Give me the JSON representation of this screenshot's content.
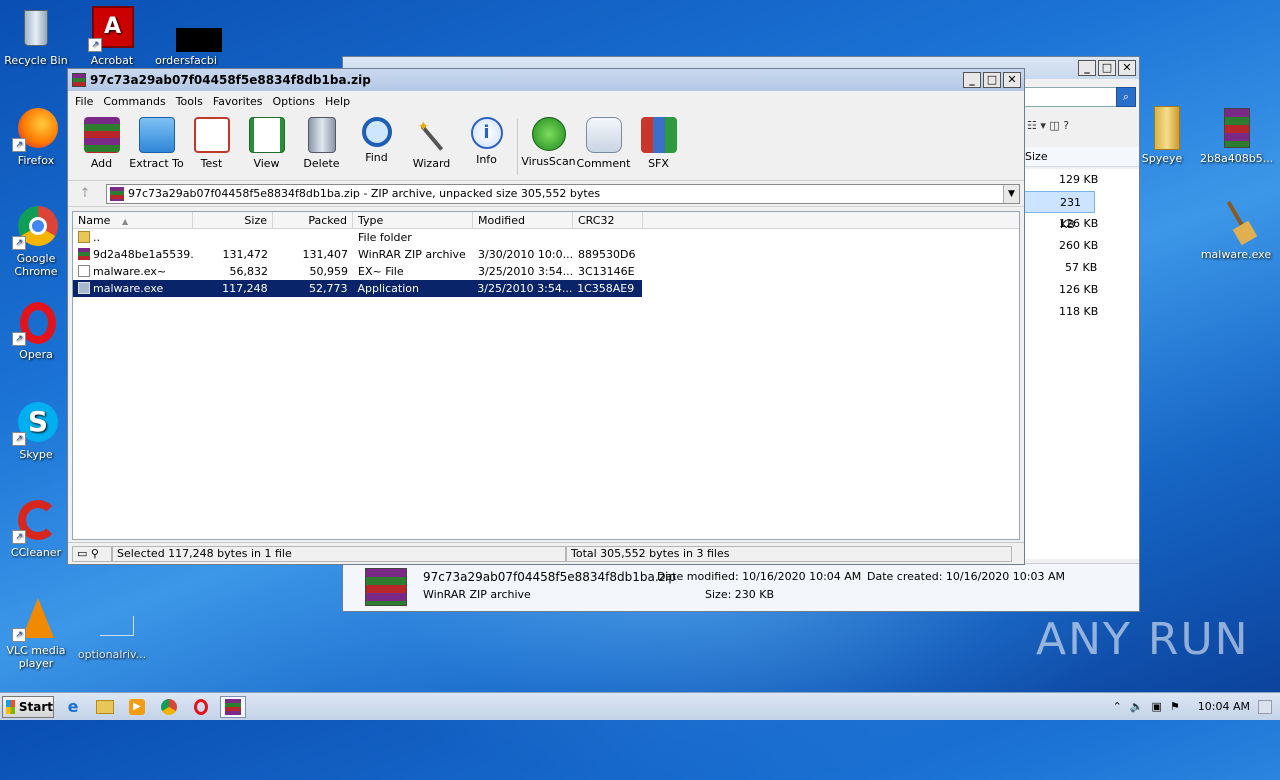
{
  "desktop": {
    "icons_left": [
      {
        "label": "Recycle Bin",
        "icon": "recycle-bin-icon"
      },
      {
        "label": "Acrobat",
        "icon": "acrobat-icon"
      },
      {
        "label": "ordersfacbi",
        "icon": "file-icon"
      },
      {
        "label": "Firefox",
        "icon": "firefox-icon"
      },
      {
        "label": "Google Chrome",
        "icon": "chrome-icon"
      },
      {
        "label": "Opera",
        "icon": "opera-icon"
      },
      {
        "label": "Skype",
        "icon": "skype-icon"
      },
      {
        "label": "CCleaner",
        "icon": "ccleaner-icon"
      },
      {
        "label": "VLC media player",
        "icon": "vlc-icon"
      },
      {
        "label": "optionalriv...",
        "icon": "file-icon"
      }
    ],
    "icons_right": [
      {
        "label": "Spyeye",
        "icon": "folder-icon"
      },
      {
        "label": "2b8a408b5...",
        "icon": "winrar-icon"
      },
      {
        "label": "malware.exe",
        "icon": "broom-icon"
      }
    ],
    "watermark": "ANY RUN"
  },
  "explorer_back": {
    "sizes": [
      "129 KB",
      "231 KB",
      "126 KB",
      "260 KB",
      "57 KB",
      "126 KB",
      "118 KB"
    ],
    "size_header": "Size",
    "details": {
      "filename": "97c73a29ab07f04458f5e8834f8db1ba.zip",
      "type": "WinRAR ZIP archive",
      "date_modified_label": "Date modified:",
      "date_modified": "10/16/2020 10:04 AM",
      "date_created_label": "Date created:",
      "date_created": "10/16/2020 10:03 AM",
      "size_label": "Size:",
      "size": "230 KB"
    }
  },
  "winrar": {
    "title": "97c73a29ab07f04458f5e8834f8db1ba.zip",
    "menu": [
      "File",
      "Commands",
      "Tools",
      "Favorites",
      "Options",
      "Help"
    ],
    "toolbar": [
      {
        "label": "Add",
        "icon": "add-icon"
      },
      {
        "label": "Extract To",
        "icon": "extract-icon"
      },
      {
        "label": "Test",
        "icon": "test-icon"
      },
      {
        "label": "View",
        "icon": "view-icon"
      },
      {
        "label": "Delete",
        "icon": "delete-icon"
      },
      {
        "label": "Find",
        "icon": "find-icon"
      },
      {
        "label": "Wizard",
        "icon": "wizard-icon"
      },
      {
        "label": "Info",
        "icon": "info-icon"
      },
      {
        "label": "VirusScan",
        "icon": "virusscan-icon"
      },
      {
        "label": "Comment",
        "icon": "comment-icon"
      },
      {
        "label": "SFX",
        "icon": "sfx-icon"
      }
    ],
    "address": "97c73a29ab07f04458f5e8834f8db1ba.zip - ZIP archive, unpacked size 305,552 bytes",
    "columns": [
      "Name",
      "Size",
      "Packed",
      "Type",
      "Modified",
      "CRC32"
    ],
    "rows": [
      {
        "name": "..",
        "size": "",
        "packed": "",
        "type": "File folder",
        "modified": "",
        "crc": "",
        "icon": "folder-up-icon"
      },
      {
        "name": "9d2a48be1a5539...",
        "size": "131,472",
        "packed": "131,407",
        "type": "WinRAR ZIP archive",
        "modified": "3/30/2010 10:0...",
        "crc": "889530D6",
        "icon": "zip-icon"
      },
      {
        "name": "malware.ex~",
        "size": "56,832",
        "packed": "50,959",
        "type": "EX~ File",
        "modified": "3/25/2010 3:54...",
        "crc": "3C13146E",
        "icon": "file-icon"
      },
      {
        "name": "malware.exe",
        "size": "117,248",
        "packed": "52,773",
        "type": "Application",
        "modified": "3/25/2010 3:54...",
        "crc": "1C358AE9",
        "icon": "exe-icon"
      }
    ],
    "status_left": "Selected 117,248 bytes in 1 file",
    "status_right": "Total 305,552 bytes in 3 files"
  },
  "taskbar": {
    "start": "Start",
    "clock": "10:04 AM"
  }
}
